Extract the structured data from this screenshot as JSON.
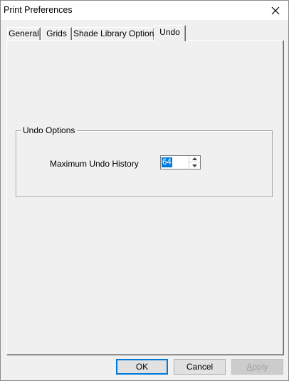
{
  "window": {
    "title": "Print Preferences"
  },
  "tabs": [
    {
      "label": "General",
      "active": false
    },
    {
      "label": "Grids",
      "active": false
    },
    {
      "label": "Shade Library Options",
      "active": false
    },
    {
      "label": "Undo",
      "active": true
    }
  ],
  "undo_options": {
    "group_label": "Undo Options",
    "max_history_label": "Maximum Undo History",
    "max_history_value": "64"
  },
  "buttons": {
    "ok": "OK",
    "cancel": "Cancel",
    "apply": "Apply"
  },
  "icons": {
    "close": "close-icon",
    "spin_up": "arrow-up-icon",
    "spin_down": "arrow-down-icon"
  },
  "colors": {
    "selection": "#0078d7",
    "face": "#f0f0f0",
    "disabled_text": "#a0a0a0"
  }
}
